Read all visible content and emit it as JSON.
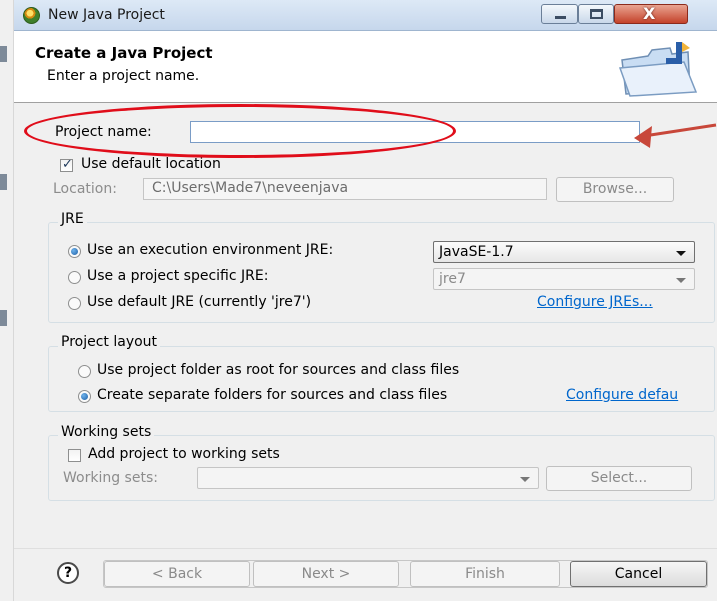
{
  "window": {
    "title": "New Java Project",
    "close_glyph": "X"
  },
  "header": {
    "title": "Create a Java Project",
    "description": "Enter a project name."
  },
  "project_name": {
    "label": "Project name:",
    "value": ""
  },
  "default_location": {
    "label": "Use default location",
    "checked": true
  },
  "location": {
    "label": "Location:",
    "value": "C:\\Users\\Made7\\neveenjava",
    "browse_label": "Browse..."
  },
  "jre": {
    "title": "JRE",
    "option_env": "Use an execution environment JRE:",
    "option_env_value": "JavaSE-1.7",
    "option_specific": "Use a project specific JRE:",
    "option_specific_value": "jre7",
    "option_default": "Use default JRE (currently 'jre7')",
    "configure_link": "Configure JREs..."
  },
  "layout": {
    "title": "Project layout",
    "option_root": "Use project folder as root for sources and class files",
    "option_separate": "Create separate folders for sources and class files",
    "configure_link": "Configure defau"
  },
  "working_sets": {
    "title": "Working sets",
    "add_label": "Add project to working sets",
    "sets_label": "Working sets:",
    "select_label": "Select..."
  },
  "footer": {
    "help_glyph": "?",
    "back_label": "< Back",
    "next_label": "Next >",
    "finish_label": "Finish",
    "cancel_label": "Cancel"
  },
  "colors": {
    "annotation": "#e00d1a",
    "link": "#0066cc",
    "titlebar": "#c6d7ec"
  },
  "icons": [
    "eclipse-icon",
    "minimize-icon",
    "maximize-icon",
    "close-icon",
    "java-project-folder-icon",
    "help-icon",
    "dropdown-arrow-icon",
    "annotation-arrow-icon"
  ]
}
